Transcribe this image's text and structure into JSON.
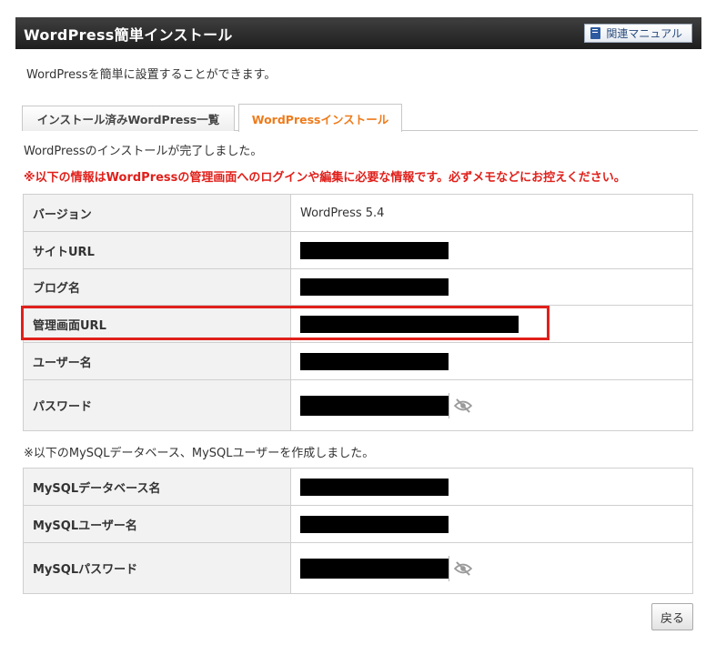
{
  "header": {
    "title": "WordPress簡単インストール",
    "manual_label": "関連マニュアル"
  },
  "intro": "WordPressを簡単に設置することができます。",
  "tabs": [
    {
      "label": "インストール済みWordPress一覧",
      "active": false
    },
    {
      "label": "WordPressインストール",
      "active": true
    }
  ],
  "complete_message": "WordPressのインストールが完了しました。",
  "warning": "※以下の情報はWordPressの管理画面へのログインや編集に必要な情報です。必ずメモなどにお控えください。",
  "wp_info": [
    {
      "label": "バージョン",
      "value": "WordPress 5.4"
    },
    {
      "label": "サイトURL",
      "value": ""
    },
    {
      "label": "ブログ名",
      "value": ""
    },
    {
      "label": "管理画面URL",
      "value": ""
    },
    {
      "label": "ユーザー名",
      "value": ""
    },
    {
      "label": "パスワード",
      "value": ""
    }
  ],
  "mysql_message": "※以下のMySQLデータベース、MySQLユーザーを作成しました。",
  "mysql_info": [
    {
      "label": "MySQLデータベース名",
      "value": ""
    },
    {
      "label": "MySQLユーザー名",
      "value": ""
    },
    {
      "label": "MySQLパスワード",
      "value": ""
    }
  ],
  "back_label": "戻る",
  "colors": {
    "accent_orange": "#ee7b1b",
    "warning_red": "#e0201b",
    "header_dark": "#2b2b2b"
  },
  "icons": {
    "manual": "book-icon",
    "password_toggle": "eye-slash-icon"
  }
}
